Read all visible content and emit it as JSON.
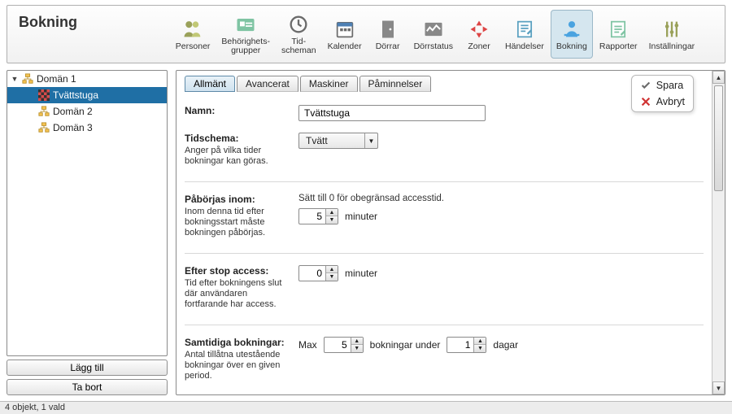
{
  "title": "Bokning",
  "toolbar": [
    {
      "id": "personer",
      "label": "Personer"
    },
    {
      "id": "behorighetsgrupper",
      "label": "Behörighets-\ngrupper"
    },
    {
      "id": "tidscheman",
      "label": "Tid-\nscheman"
    },
    {
      "id": "kalender",
      "label": "Kalender"
    },
    {
      "id": "dorrar",
      "label": "Dörrar"
    },
    {
      "id": "dorrstatus",
      "label": "Dörrstatus"
    },
    {
      "id": "zoner",
      "label": "Zoner"
    },
    {
      "id": "handelser",
      "label": "Händelser"
    },
    {
      "id": "bokning",
      "label": "Bokning",
      "active": true
    },
    {
      "id": "rapporter",
      "label": "Rapporter"
    },
    {
      "id": "installningar",
      "label": "Inställningar"
    }
  ],
  "sidebar": {
    "tree": {
      "root": {
        "label": "Domän 1",
        "expanded": true
      },
      "children": [
        {
          "label": "Tvättstuga",
          "selected": true,
          "icon": "checker"
        },
        {
          "label": "Domän 2",
          "icon": "org"
        },
        {
          "label": "Domän 3",
          "icon": "org"
        }
      ]
    },
    "add_label": "Lägg till",
    "remove_label": "Ta bort"
  },
  "status": "4 objekt, 1 vald",
  "tabs": [
    {
      "id": "allmant",
      "label": "Allmänt",
      "active": true
    },
    {
      "id": "avancerat",
      "label": "Avancerat"
    },
    {
      "id": "maskiner",
      "label": "Maskiner"
    },
    {
      "id": "paminnelser",
      "label": "Påminnelser"
    }
  ],
  "actions": {
    "save": "Spara",
    "cancel": "Avbryt"
  },
  "form": {
    "name": {
      "label": "Namn:",
      "value": "Tvättstuga"
    },
    "tidschema": {
      "label": "Tidschema:",
      "sub": "Anger på vilka tider bokningar kan göras.",
      "value": "Tvätt"
    },
    "paborjas": {
      "label": "Påbörjas inom:",
      "sub": "Inom denna tid efter bokningsstart måste bokningen påbörjas.",
      "hint": "Sätt till 0 för obegränsad accesstid.",
      "value": "5",
      "unit": "minuter"
    },
    "efter_stop": {
      "label": "Efter stop access:",
      "sub": "Tid efter bokningens slut där användaren fortfarande har access.",
      "value": "0",
      "unit": "minuter"
    },
    "samtidiga": {
      "label": "Samtidiga bokningar:",
      "sub": "Antal tillåtna utestående bokningar över en given period.",
      "prefix": "Max",
      "value1": "5",
      "mid": "bokningar under",
      "value2": "1",
      "suffix": "dagar"
    }
  }
}
